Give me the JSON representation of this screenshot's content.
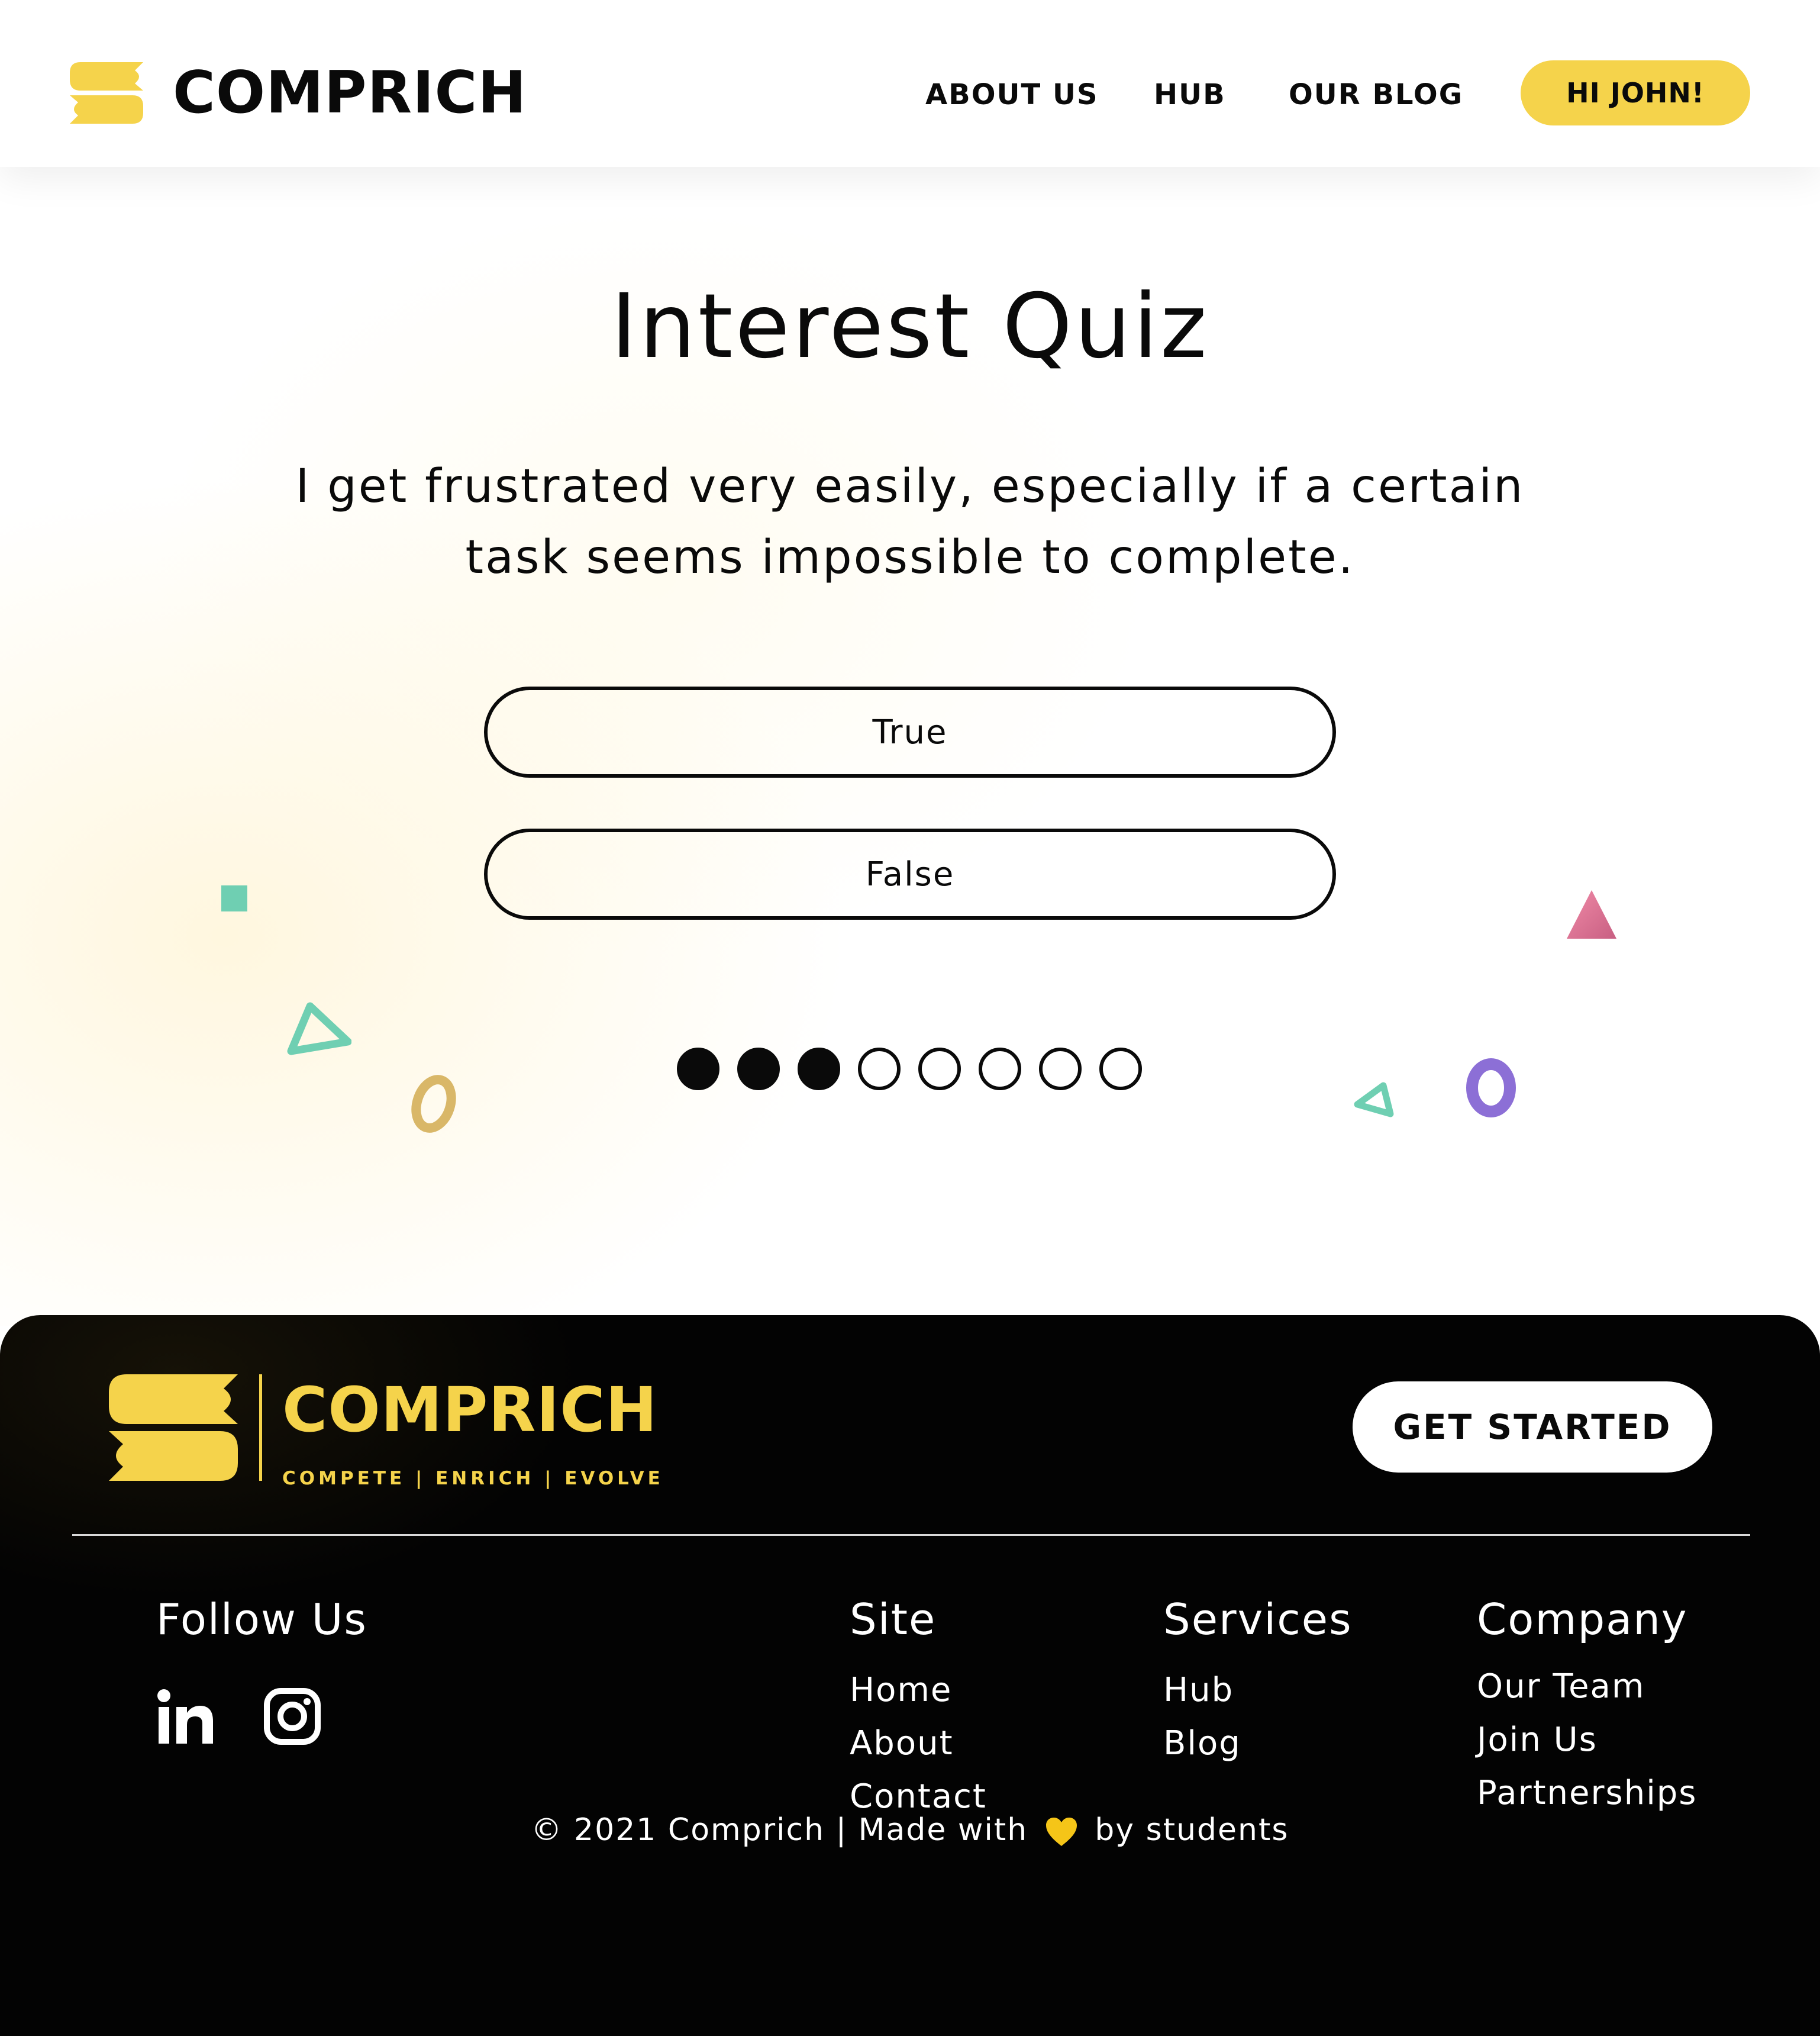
{
  "header": {
    "brand_name": "COMPRICH",
    "nav": [
      {
        "label": "ABOUT US"
      },
      {
        "label": "HUB"
      },
      {
        "label": "OUR BLOG"
      }
    ],
    "user_button_label": "HI JOHN!"
  },
  "quiz": {
    "title": "Interest Quiz",
    "question": "I get frustrated very easily, especially if a certain task seems impossible to complete.",
    "answers": [
      {
        "label": "True"
      },
      {
        "label": "False"
      }
    ],
    "progress": {
      "current": 3,
      "total": 8
    }
  },
  "footer": {
    "brand_name": "COMPRICH",
    "tagline": "COMPETE | ENRICH | EVOLVE",
    "cta_label": "GET STARTED",
    "follow": {
      "title": "Follow Us",
      "icons": [
        "linkedin-icon",
        "instagram-icon"
      ]
    },
    "columns": [
      {
        "title": "Site",
        "links": [
          "Home",
          "About",
          "Contact"
        ]
      },
      {
        "title": "Services",
        "links": [
          "Hub",
          "Blog"
        ]
      },
      {
        "title": "Company",
        "links": [
          "Our Team",
          "Join Us",
          "Partnerships"
        ]
      }
    ],
    "copyright_before": "© 2021 Comprich | Made with",
    "copyright_after": "by students"
  },
  "colors": {
    "brand_yellow": "#f5d34b",
    "text_dark": "#0a0a0a",
    "footer_bg": "#030303",
    "shape_teal": "#6fcfb2",
    "shape_pink": "#e17a98",
    "shape_purple": "#8c6fd6",
    "shape_gold": "#d9b768"
  }
}
